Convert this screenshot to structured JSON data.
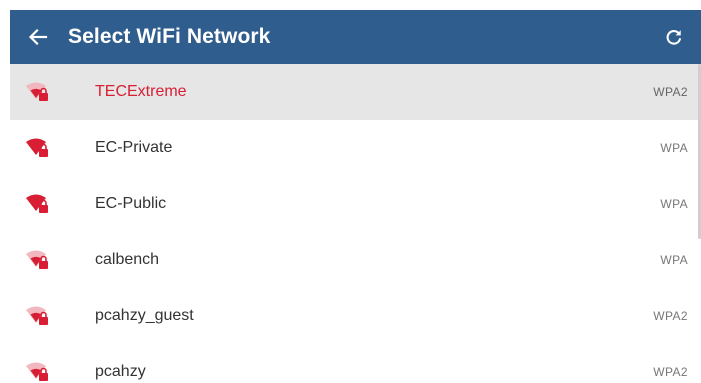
{
  "header": {
    "title": "Select WiFi Network",
    "back_icon": "arrow-left-icon",
    "refresh_icon": "refresh-icon",
    "background_color": "#2f5d8e"
  },
  "accent_color": "#d81e34",
  "networks": [
    {
      "ssid": "TECExtreme",
      "security": "WPA2",
      "selected": true,
      "signal": "weak"
    },
    {
      "ssid": "EC-Private",
      "security": "WPA",
      "selected": false,
      "signal": "strong"
    },
    {
      "ssid": "EC-Public",
      "security": "WPA",
      "selected": false,
      "signal": "strong"
    },
    {
      "ssid": "calbench",
      "security": "WPA",
      "selected": false,
      "signal": "weak"
    },
    {
      "ssid": "pcahzy_guest",
      "security": "WPA2",
      "selected": false,
      "signal": "weak"
    },
    {
      "ssid": "pcahzy",
      "security": "WPA2",
      "selected": false,
      "signal": "weak"
    }
  ]
}
